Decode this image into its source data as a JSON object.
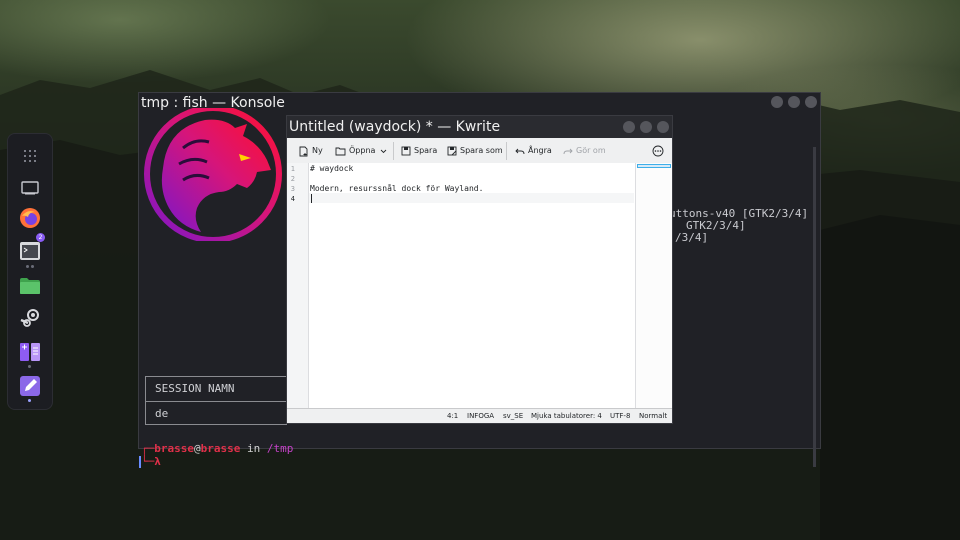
{
  "konsole": {
    "title": "tmp : fish — Konsole",
    "session_header": "SESSION NAMN",
    "session_value": "de",
    "side_lines": [
      "uttons-v40 [GTK2/3/4]",
      "GTK2/3/4]",
      "/3/4]"
    ],
    "prompt_user": "brasse",
    "prompt_at": "@",
    "prompt_host": "brasse",
    "prompt_in": " in ",
    "prompt_dir": "/tmp",
    "prompt_lambda": "λ",
    "prompt_corner_top": "┌─",
    "prompt_corner_bottom": "└─"
  },
  "kwrite": {
    "title": "Untitled (waydock) * — Kwrite",
    "toolbar": {
      "new": "Ny",
      "open": "Öppna",
      "save": "Spara",
      "save_as": "Spara som",
      "undo": "Ångra",
      "redo": "Gör om"
    },
    "lines": [
      "# waydock",
      "",
      "Modern, resurssnål dock för Wayland.",
      ""
    ],
    "line_numbers": [
      "1",
      "2",
      "3",
      "4"
    ],
    "status": {
      "position": "4:1",
      "mode": "INFOGA",
      "language": "sv_SE",
      "indent": "Mjuka tabulatorer: 4",
      "encoding": "UTF-8",
      "syntax": "Normalt"
    }
  },
  "dock": {
    "items": [
      "app-grid-icon",
      "desktop-icon",
      "firefox-icon",
      "terminal-icon",
      "files-icon",
      "steam-icon",
      "split-view-icon",
      "text-editor-icon"
    ],
    "terminal_badge": "2"
  },
  "colors": {
    "accent": "#3daee9",
    "prompt_red": "#e0304a",
    "prompt_magenta": "#c542c8",
    "logo_red": "#ff1030",
    "logo_purple": "#7c16c9"
  }
}
